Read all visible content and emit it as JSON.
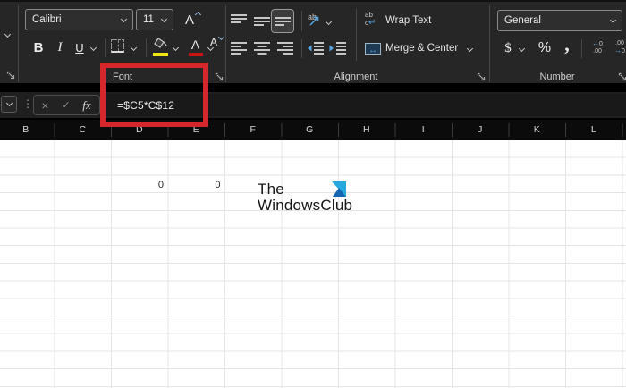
{
  "ribbon": {
    "font": {
      "group_label": "Font",
      "font_name": "Calibri",
      "font_size": "11",
      "bold": "B",
      "italic": "I",
      "underline": "U",
      "grow_font_letter": "A",
      "shrink_font_letter": "A",
      "font_color_letter": "A",
      "fill_color": "#f3e712",
      "font_color": "#c41414"
    },
    "alignment": {
      "group_label": "Alignment",
      "orientation_text": "ab",
      "wrap_icon_top": "ab",
      "wrap_icon_bottom": "c",
      "wrap_icon_arrow": "↵",
      "wrap_text_label": "Wrap Text",
      "merge_icon_arrow": "↔",
      "merge_center_label": "Merge & Center"
    },
    "number": {
      "group_label": "Number",
      "format_value": "General",
      "currency": "$",
      "percent": "%",
      "comma": ",",
      "inc_dec_top_arrow": "←",
      "inc_dec_top_num": "0",
      "inc_dec_bottom": ".00",
      "dec_dec_top": ".00",
      "dec_dec_bottom_arrow": "→",
      "dec_dec_bottom_num": "0"
    }
  },
  "formula_bar": {
    "dots": "⋮",
    "cancel": "×",
    "enter": "✓",
    "fx": "fx",
    "formula": "=$C5*C$12"
  },
  "sheet": {
    "columns": [
      "B",
      "C",
      "D",
      "E",
      "F",
      "G",
      "H",
      "I",
      "J",
      "K",
      "L"
    ],
    "cells": [
      {
        "column": "D",
        "value": "0"
      },
      {
        "column": "E",
        "value": "0"
      }
    ]
  },
  "watermark": {
    "line1": "The",
    "line2": "WindowsClub"
  },
  "annotation": {
    "shape": "rectangle",
    "color": "#d6282c"
  },
  "accents": {
    "icon_blue": "#57a7e4",
    "header_text": "#dadada",
    "grid_line": "#e4e4e9"
  }
}
